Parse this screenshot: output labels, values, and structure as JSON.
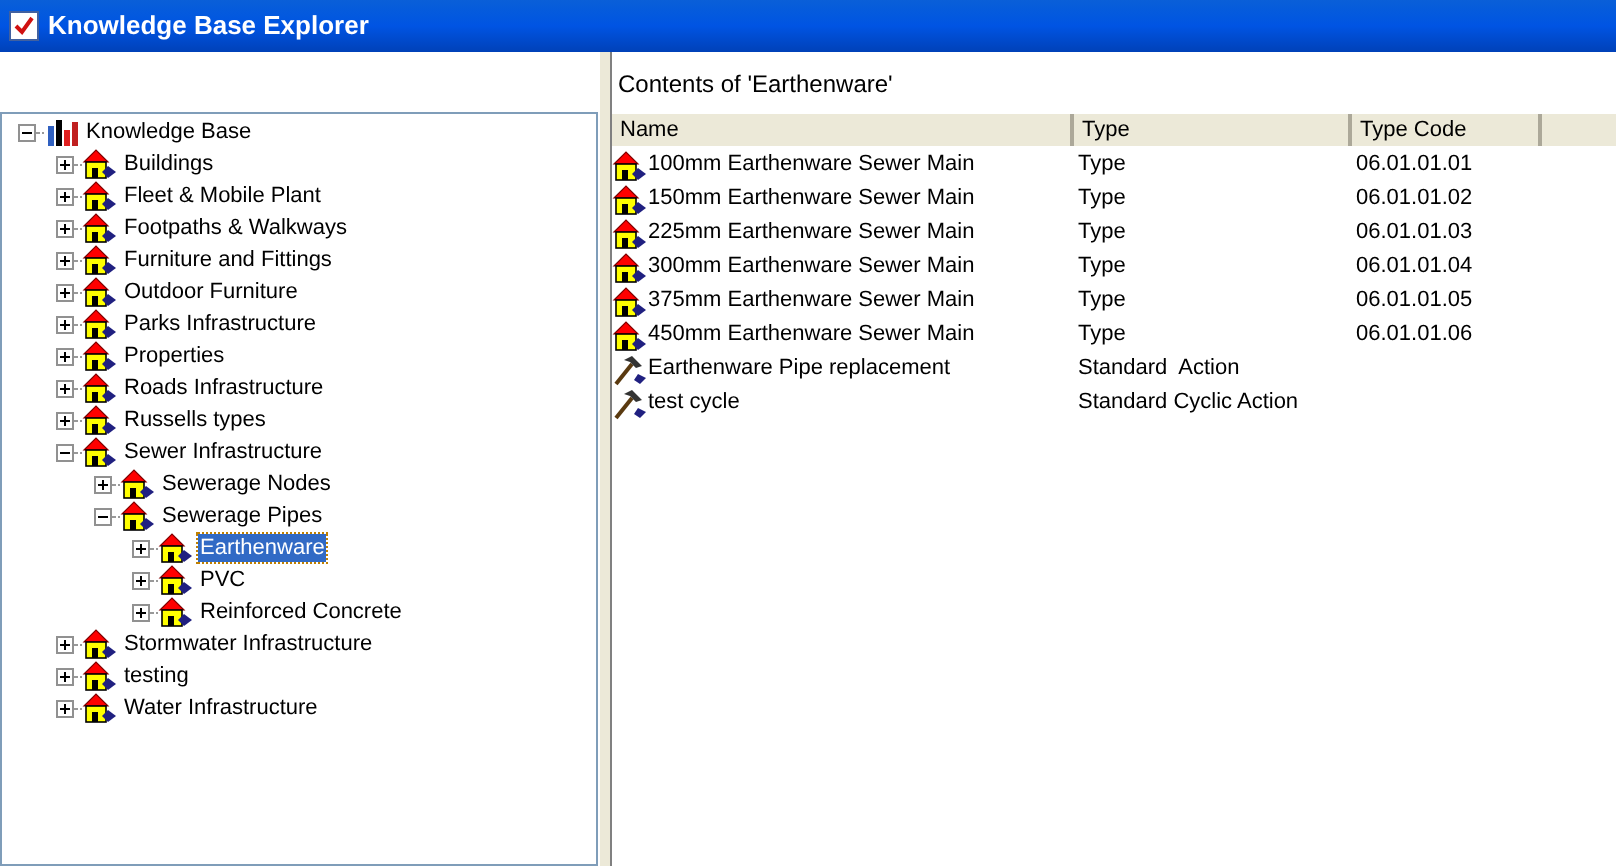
{
  "window": {
    "title": "Knowledge Base Explorer"
  },
  "tree": [
    {
      "label": "Knowledge Base",
      "kind": "root",
      "expanded": true,
      "selected": false,
      "children": [
        {
          "label": "Buildings",
          "kind": "folder",
          "expanded": false,
          "selected": false
        },
        {
          "label": "Fleet & Mobile Plant",
          "kind": "folder",
          "expanded": false,
          "selected": false
        },
        {
          "label": "Footpaths & Walkways",
          "kind": "folder",
          "expanded": false,
          "selected": false
        },
        {
          "label": "Furniture and Fittings",
          "kind": "folder",
          "expanded": false,
          "selected": false
        },
        {
          "label": "Outdoor Furniture",
          "kind": "folder",
          "expanded": false,
          "selected": false
        },
        {
          "label": "Parks Infrastructure",
          "kind": "folder",
          "expanded": false,
          "selected": false
        },
        {
          "label": "Properties",
          "kind": "folder",
          "expanded": false,
          "selected": false
        },
        {
          "label": "Roads Infrastructure",
          "kind": "folder",
          "expanded": false,
          "selected": false
        },
        {
          "label": "Russells types",
          "kind": "folder",
          "expanded": false,
          "selected": false
        },
        {
          "label": "Sewer Infrastructure",
          "kind": "folder",
          "expanded": true,
          "selected": false,
          "children": [
            {
              "label": "Sewerage Nodes",
              "kind": "folder",
              "expanded": false,
              "selected": false
            },
            {
              "label": "Sewerage Pipes",
              "kind": "folder",
              "expanded": true,
              "selected": false,
              "children": [
                {
                  "label": "Earthenware",
                  "kind": "folder",
                  "expanded": false,
                  "selected": true
                },
                {
                  "label": "PVC",
                  "kind": "folder",
                  "expanded": false,
                  "selected": false
                },
                {
                  "label": "Reinforced Concrete",
                  "kind": "folder",
                  "expanded": false,
                  "selected": false
                }
              ]
            }
          ]
        },
        {
          "label": "Stormwater Infrastructure",
          "kind": "folder",
          "expanded": false,
          "selected": false
        },
        {
          "label": "testing",
          "kind": "folder",
          "expanded": false,
          "selected": false
        },
        {
          "label": "Water Infrastructure",
          "kind": "folder",
          "expanded": false,
          "selected": false
        }
      ]
    }
  ],
  "contents": {
    "title": "Contents of 'Earthenware'",
    "columns": [
      "Name",
      "Type",
      "Type Code"
    ],
    "rows": [
      {
        "kind": "type",
        "name": "100mm Earthenware Sewer Main",
        "type": "Type",
        "type_code": "06.01.01.01"
      },
      {
        "kind": "type",
        "name": "150mm Earthenware Sewer Main",
        "type": "Type",
        "type_code": "06.01.01.02"
      },
      {
        "kind": "type",
        "name": "225mm Earthenware Sewer Main",
        "type": "Type",
        "type_code": "06.01.01.03"
      },
      {
        "kind": "type",
        "name": "300mm Earthenware Sewer Main",
        "type": "Type",
        "type_code": "06.01.01.04"
      },
      {
        "kind": "type",
        "name": "375mm Earthenware Sewer Main",
        "type": "Type",
        "type_code": "06.01.01.05"
      },
      {
        "kind": "type",
        "name": "450mm Earthenware Sewer Main",
        "type": "Type",
        "type_code": "06.01.01.06"
      },
      {
        "kind": "action",
        "name": "Earthenware Pipe replacement",
        "type": "Standard  Action"
      },
      {
        "kind": "action",
        "name": "test cycle",
        "type": "Standard Cyclic Action"
      }
    ]
  }
}
